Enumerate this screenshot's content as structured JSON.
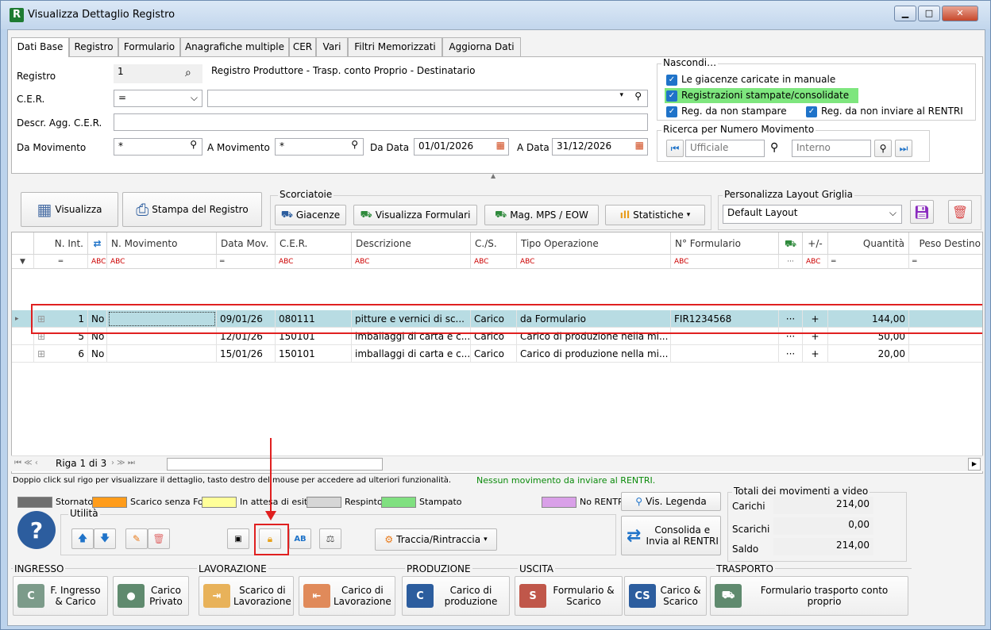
{
  "window": {
    "title": "Visualizza Dettaglio Registro",
    "app_icon": "R"
  },
  "tabs": [
    "Dati Base",
    "Registro",
    "Formulario",
    "Anagrafiche multiple",
    "CER",
    "Vari",
    "Filtri Memorizzati",
    "Aggiorna Dati"
  ],
  "form": {
    "registro_label": "Registro",
    "registro_value": "1",
    "registro_desc": "Registro Produttore - Trasp. conto Proprio - Destinatario",
    "cer_label": "C.E.R.",
    "cer_op": "=",
    "cer_value": "",
    "descr_label": "Descr. Agg. C.E.R.",
    "descr_value": "",
    "da_mov_label": "Da Movimento",
    "da_mov_value": "*",
    "a_mov_label": "A Movimento",
    "a_mov_value": "*",
    "da_data_label": "Da Data",
    "da_data_value": "01/01/2026",
    "a_data_label": "A Data",
    "a_data_value": "31/12/2026"
  },
  "nascondi": {
    "title": "Nascondi…",
    "opt1": "Le giacenze caricate in manuale",
    "opt2": "Registrazioni stampate/consolidate",
    "opt3": "Reg. da non stampare",
    "opt4": "Reg. da non inviare al RENTRI"
  },
  "ricerca": {
    "title": "Ricerca per Numero Movimento",
    "ufficiale_placeholder": "Ufficiale",
    "interno_placeholder": "Interno"
  },
  "toolbar": {
    "visualizza": "Visualizza",
    "stampa": "Stampa del Registro",
    "scorciatoie": "Scorciatoie",
    "giacenze": "Giacenze",
    "vis_formulari": "Visualizza Formulari",
    "mag": "Mag. MPS / EOW",
    "statistiche": "Statistiche",
    "layout_title": "Personalizza Layout Griglia",
    "layout_value": "Default Layout"
  },
  "grid": {
    "headers": [
      "N. Int.",
      "",
      "N. Movimento",
      "Data Mov.",
      "C.E.R.",
      "Descrizione",
      "C./S.",
      "Tipo Operazione",
      "N° Formulario",
      "",
      "+/-",
      "Quantità",
      "Peso Destino"
    ],
    "rows": [
      {
        "nint": "1",
        "rentri": "No",
        "nmov": "",
        "data": "09/01/26",
        "cer": "080111",
        "descr": "pitture e vernici di sc...",
        "cs": "Carico",
        "tipo": "da Formulario",
        "formulario": "FIR1234568",
        "dots": "···",
        "pm": "+",
        "qta": "144,00"
      },
      {
        "nint": "5",
        "rentri": "No",
        "nmov": "",
        "data": "12/01/26",
        "cer": "150101",
        "descr": "imballaggi di carta e c...",
        "cs": "Carico",
        "tipo": "Carico di produzione nella mi...",
        "formulario": "",
        "dots": "···",
        "pm": "+",
        "qta": "50,00"
      },
      {
        "nint": "6",
        "rentri": "No",
        "nmov": "",
        "data": "15/01/26",
        "cer": "150101",
        "descr": "imballaggi di carta e c...",
        "cs": "Carico",
        "tipo": "Carico di produzione nella mi...",
        "formulario": "",
        "dots": "···",
        "pm": "+",
        "qta": "20,00"
      }
    ],
    "pager": "Riga 1 di 3"
  },
  "hint": "Doppio click sul rigo per visualizzare il dettaglio, tasto destro del mouse per accedere ad ulteriori funzionalità.",
  "rentri_msg": "Nessun movimento da inviare al RENTRI.",
  "legend": [
    {
      "label": "Stornato",
      "color": "#6f6f6f"
    },
    {
      "label": "Scarico senza Form.",
      "color": "#ff9c1a"
    },
    {
      "label": "In attesa di esito",
      "color": "#ffff99"
    },
    {
      "label": "Respinto",
      "color": "#d6d6d6"
    },
    {
      "label": "Stampato",
      "color": "#80e080"
    },
    {
      "label": "No RENTRI",
      "color": "#d9a0e8"
    }
  ],
  "vis_legenda": "Vis. Legenda",
  "totali": {
    "title": "Totali dei movimenti a video",
    "carichi_label": "Carichi",
    "carichi": "214,00",
    "scarichi_label": "Scarichi",
    "scarichi": "0,00",
    "saldo_label": "Saldo",
    "saldo": "214,00"
  },
  "utilita": {
    "title": "Utilità",
    "traccia": "Traccia/Rintraccia",
    "consolida": "Consolida e Invia al RENTRI"
  },
  "sections": {
    "ingresso": "INGRESSO",
    "lavorazione": "LAVORAZIONE",
    "produzione": "PRODUZIONE",
    "uscita": "USCITA",
    "trasporto": "TRASPORTO",
    "b_ingresso": "F. Ingresso & Carico",
    "b_privato": "Carico Privato",
    "b_scarico_lav": "Scarico di Lavorazione",
    "b_carico_lav": "Carico di Lavorazione",
    "b_produzione": "Carico di produzione",
    "b_formulario": "Formulario & Scarico",
    "b_carico_scarico": "Carico & Scarico",
    "b_trasporto": "Formulario trasporto conto proprio"
  },
  "colors": {
    "selected_row": "#b8dce3",
    "accent": "#1f73c9",
    "highlight": "#7ee67e",
    "red": "#e02020"
  }
}
